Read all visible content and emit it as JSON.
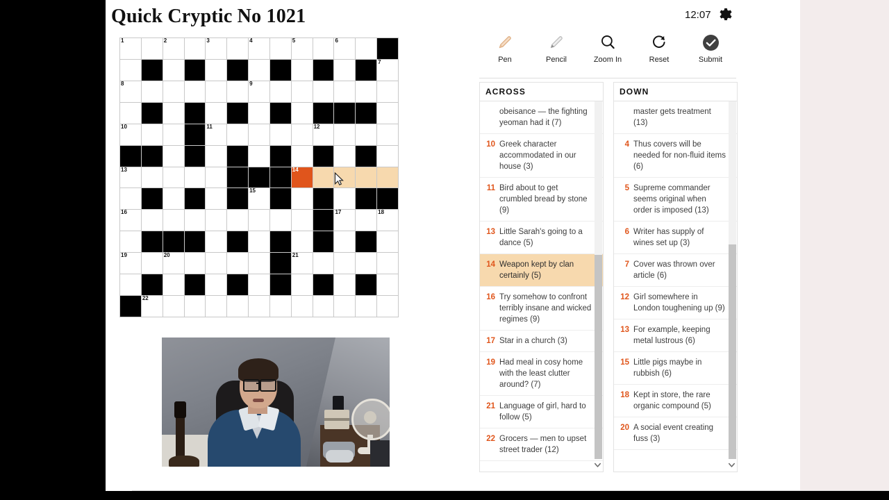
{
  "header": {
    "title": "Quick Cryptic No 1021",
    "clock": "12:07",
    "gear_icon": "gear-icon"
  },
  "toolbar": {
    "items": [
      {
        "label": "Pen",
        "icon": "pen-icon"
      },
      {
        "label": "Pencil",
        "icon": "pencil-icon"
      },
      {
        "label": "Zoom In",
        "icon": "magnifier-icon"
      },
      {
        "label": "Reset",
        "icon": "refresh-icon"
      },
      {
        "label": "Submit",
        "icon": "check-circle-icon"
      }
    ]
  },
  "colors": {
    "accent_orange": "#e0561c",
    "highlight_tan": "#f7d9ae",
    "cursor_cell": "#e0551c",
    "grid_black": "#000000",
    "grid_line": "#c8c8c8"
  },
  "grid": {
    "rows": 13,
    "cols": 13,
    "selected_clue": "14 across",
    "cursor_cell": {
      "row": 6,
      "col": 8
    },
    "highlighted_cells": [
      {
        "row": 6,
        "col": 9
      },
      {
        "row": 6,
        "col": 10
      },
      {
        "row": 6,
        "col": 11
      },
      {
        "row": 6,
        "col": 12
      }
    ],
    "black_cells": [
      {
        "row": 0,
        "col": 12
      },
      {
        "row": 1,
        "col": 1
      },
      {
        "row": 1,
        "col": 3
      },
      {
        "row": 1,
        "col": 5
      },
      {
        "row": 1,
        "col": 7
      },
      {
        "row": 1,
        "col": 9
      },
      {
        "row": 1,
        "col": 11
      },
      {
        "row": 3,
        "col": 1
      },
      {
        "row": 3,
        "col": 3
      },
      {
        "row": 3,
        "col": 5
      },
      {
        "row": 3,
        "col": 7
      },
      {
        "row": 3,
        "col": 9
      },
      {
        "row": 3,
        "col": 10
      },
      {
        "row": 3,
        "col": 11
      },
      {
        "row": 4,
        "col": 3
      },
      {
        "row": 5,
        "col": 0
      },
      {
        "row": 5,
        "col": 1
      },
      {
        "row": 5,
        "col": 3
      },
      {
        "row": 5,
        "col": 5
      },
      {
        "row": 5,
        "col": 7
      },
      {
        "row": 5,
        "col": 9
      },
      {
        "row": 5,
        "col": 11
      },
      {
        "row": 6,
        "col": 5
      },
      {
        "row": 6,
        "col": 6
      },
      {
        "row": 6,
        "col": 7
      },
      {
        "row": 7,
        "col": 1
      },
      {
        "row": 7,
        "col": 3
      },
      {
        "row": 7,
        "col": 5
      },
      {
        "row": 7,
        "col": 7
      },
      {
        "row": 7,
        "col": 9
      },
      {
        "row": 7,
        "col": 11
      },
      {
        "row": 7,
        "col": 12
      },
      {
        "row": 8,
        "col": 9
      },
      {
        "row": 9,
        "col": 1
      },
      {
        "row": 9,
        "col": 2
      },
      {
        "row": 9,
        "col": 3
      },
      {
        "row": 9,
        "col": 5
      },
      {
        "row": 9,
        "col": 7
      },
      {
        "row": 9,
        "col": 9
      },
      {
        "row": 9,
        "col": 11
      },
      {
        "row": 10,
        "col": 7
      },
      {
        "row": 11,
        "col": 1
      },
      {
        "row": 11,
        "col": 3
      },
      {
        "row": 11,
        "col": 5
      },
      {
        "row": 11,
        "col": 7
      },
      {
        "row": 11,
        "col": 9
      },
      {
        "row": 11,
        "col": 11
      },
      {
        "row": 12,
        "col": 0
      }
    ],
    "numbers": [
      {
        "row": 0,
        "col": 0,
        "n": "1"
      },
      {
        "row": 0,
        "col": 2,
        "n": "2"
      },
      {
        "row": 0,
        "col": 4,
        "n": "3"
      },
      {
        "row": 0,
        "col": 6,
        "n": "4"
      },
      {
        "row": 0,
        "col": 8,
        "n": "5"
      },
      {
        "row": 0,
        "col": 10,
        "n": "6"
      },
      {
        "row": 1,
        "col": 12,
        "n": "7"
      },
      {
        "row": 2,
        "col": 0,
        "n": "8"
      },
      {
        "row": 2,
        "col": 6,
        "n": "9"
      },
      {
        "row": 4,
        "col": 0,
        "n": "10"
      },
      {
        "row": 4,
        "col": 4,
        "n": "11"
      },
      {
        "row": 4,
        "col": 9,
        "n": "12"
      },
      {
        "row": 6,
        "col": 0,
        "n": "13"
      },
      {
        "row": 6,
        "col": 8,
        "n": "14"
      },
      {
        "row": 7,
        "col": 6,
        "n": "15"
      },
      {
        "row": 8,
        "col": 0,
        "n": "16"
      },
      {
        "row": 8,
        "col": 10,
        "n": "17"
      },
      {
        "row": 8,
        "col": 12,
        "n": "18"
      },
      {
        "row": 10,
        "col": 0,
        "n": "19"
      },
      {
        "row": 10,
        "col": 2,
        "n": "20"
      },
      {
        "row": 10,
        "col": 8,
        "n": "21"
      },
      {
        "row": 12,
        "col": 1,
        "n": "22"
      }
    ]
  },
  "across": {
    "heading": "ACROSS",
    "clues": [
      {
        "num": "",
        "text": "obeisance — the fighting yeoman had it (7)",
        "selected": false,
        "partial": true
      },
      {
        "num": "10",
        "text": "Greek character accommodated in our house (3)",
        "selected": false
      },
      {
        "num": "11",
        "text": "Bird about to get crumbled bread by stone (9)",
        "selected": false
      },
      {
        "num": "13",
        "text": "Little Sarah's going to a dance (5)",
        "selected": false
      },
      {
        "num": "14",
        "text": "Weapon kept by clan certainly (5)",
        "selected": true
      },
      {
        "num": "16",
        "text": "Try somehow to confront terribly insane and wicked regimes (9)",
        "selected": false
      },
      {
        "num": "17",
        "text": "Star in a church (3)",
        "selected": false
      },
      {
        "num": "19",
        "text": "Had meal in cosy home with the least clutter around? (7)",
        "selected": false
      },
      {
        "num": "21",
        "text": "Language of girl, hard to follow (5)",
        "selected": false
      },
      {
        "num": "22",
        "text": "Grocers — men to upset street trader (12)",
        "selected": false
      }
    ]
  },
  "down": {
    "heading": "DOWN",
    "clues": [
      {
        "num": "",
        "text": "master gets treatment (13)",
        "selected": false,
        "partial": true
      },
      {
        "num": "4",
        "text": "Thus covers will be needed for non-fluid items (6)",
        "selected": false
      },
      {
        "num": "5",
        "text": "Supreme commander seems original when order is imposed (13)",
        "selected": false
      },
      {
        "num": "6",
        "text": "Writer has supply of wines set up (3)",
        "selected": false
      },
      {
        "num": "7",
        "text": "Cover was thrown over article (6)",
        "selected": false
      },
      {
        "num": "12",
        "text": "Girl somewhere in London toughening up (9)",
        "selected": false
      },
      {
        "num": "13",
        "text": "For example, keeping metal lustrous (6)",
        "selected": false
      },
      {
        "num": "15",
        "text": "Little pigs maybe in rubbish (6)",
        "selected": false
      },
      {
        "num": "18",
        "text": "Kept in store, the rare organic compound (5)",
        "selected": false
      },
      {
        "num": "20",
        "text": "A social event creating fuss (3)",
        "selected": false
      }
    ]
  },
  "scrollbars": {
    "across": {
      "thumb_top_pct": 43,
      "thumb_height_pct": 57
    },
    "down": {
      "thumb_top_pct": 40,
      "thumb_height_pct": 60
    }
  },
  "webcam": {
    "label": "webcam-video-overlay"
  }
}
